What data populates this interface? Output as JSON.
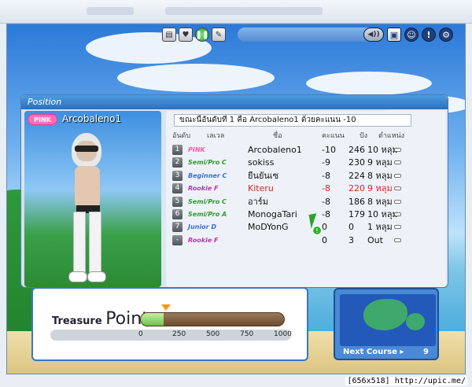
{
  "window": {
    "title": ""
  },
  "toolbar": {
    "left_icons": [
      "scorecard-icon",
      "gift-icon",
      "pause-icon",
      "chat-icon"
    ],
    "right_icons": [
      "speaker-icon",
      "window-icon",
      "people-icon",
      "info-icon",
      "gear-icon"
    ]
  },
  "position": {
    "title": "Position",
    "character": {
      "rank_badge": "PINK",
      "name": "Arcobaleno1"
    },
    "status_text": "ขณะนี้อันดับที่ 1 คือ Arcobaleno1 ด้วยคะแนน -10",
    "headers": [
      "อันดับ",
      "เลเวล",
      "ชื่อ",
      "คะแนน",
      "ปัง",
      "ตำแหน่ง"
    ],
    "rows": [
      {
        "rank": "1",
        "level": "PINK",
        "level_color": "#ff5aa8",
        "name": "Arcobaleno1",
        "score": "-10",
        "shots": "246",
        "position": "10 หลุม",
        "highlight": false
      },
      {
        "rank": "2",
        "level": "Semi/Pro C",
        "level_color": "#2f9a2f",
        "name": "sokiss",
        "score": "-9",
        "shots": "230",
        "position": "9 หลุม",
        "highlight": false
      },
      {
        "rank": "3",
        "level": "Beginner C",
        "level_color": "#3a6fd1",
        "name": "ยืนยันเซ",
        "score": "-8",
        "shots": "224",
        "position": "8 หลุม",
        "highlight": false
      },
      {
        "rank": "4",
        "level": "Rookie F",
        "level_color": "#c234b0",
        "name": "Kiteru",
        "score": "-8",
        "shots": "220",
        "position": "9 หลุม",
        "highlight": true
      },
      {
        "rank": "5",
        "level": "Semi/Pro C",
        "level_color": "#2f9a2f",
        "name": "อาร์ม",
        "score": "-8",
        "shots": "186",
        "position": "8 หลุม",
        "highlight": false
      },
      {
        "rank": "6",
        "level": "Semi/Pro A",
        "level_color": "#2f9a2f",
        "name": "MonogaTari",
        "score": "-8",
        "shots": "179",
        "position": "10 หลุม",
        "highlight": false
      },
      {
        "rank": "7",
        "level": "Junior D",
        "level_color": "#3a6fd1",
        "name": "MoDYonG",
        "score": "0",
        "shots": "0",
        "position": "1 หลุม",
        "highlight": false
      },
      {
        "rank": "-",
        "level": "Rookie F",
        "level_color": "#c234b0",
        "name": "",
        "score": "0",
        "shots": "3",
        "position": "Out",
        "highlight": false
      }
    ]
  },
  "treasure": {
    "label_small": "Treasure",
    "label_big": "Point",
    "fill_fraction": 0.16,
    "ticks": [
      "0",
      "250",
      "500",
      "750",
      "1000"
    ]
  },
  "course": {
    "next_label": "Next Course",
    "arrow": "▸",
    "number": "9"
  },
  "watermark": "[656x518] http://upic.me/"
}
